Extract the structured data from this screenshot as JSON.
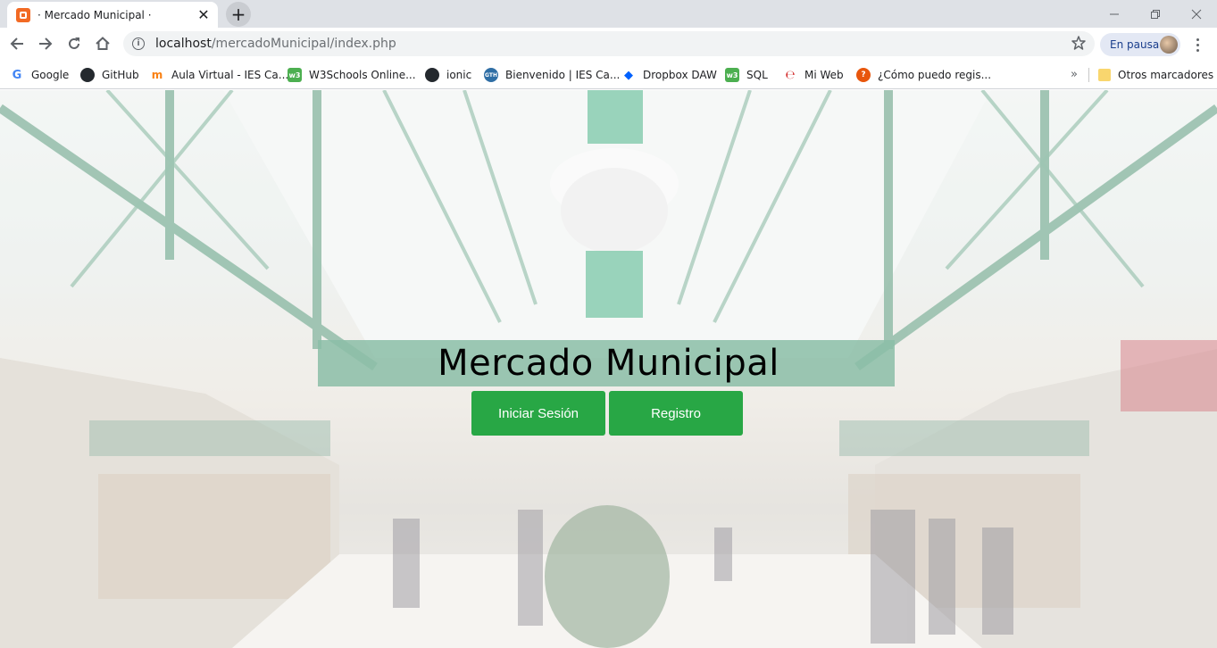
{
  "browser": {
    "tab": {
      "title": "· Mercado Municipal ·",
      "close_glyph": "✕"
    },
    "new_tab_glyph": "+",
    "url": {
      "host": "localhost",
      "path": "/mercadoMunicipal/index.php"
    },
    "profile_label": "En pausa",
    "bookmarks": [
      {
        "label": "Google",
        "icon": "google-icon",
        "color": "#4285f4"
      },
      {
        "label": "GitHub",
        "icon": "github-icon",
        "color": "#24292e"
      },
      {
        "label": "Aula Virtual - IES Ca...",
        "icon": "moodle-icon",
        "color": "#f98012"
      },
      {
        "label": "W3Schools Online...",
        "icon": "w3schools-icon",
        "color": "#4caf50"
      },
      {
        "label": "ionic",
        "icon": "github-icon",
        "color": "#24292e"
      },
      {
        "label": "Bienvenido | IES Ca...",
        "icon": "ies-icon",
        "color": "#2f6ea5"
      },
      {
        "label": "Dropbox DAW",
        "icon": "dropbox-icon",
        "color": "#0061fe"
      },
      {
        "label": "SQL",
        "icon": "w3schools-icon",
        "color": "#4caf50"
      },
      {
        "label": "Mi Web",
        "icon": "web-icon",
        "color": "#d32f2f"
      },
      {
        "label": "¿Cómo puedo regis...",
        "icon": "help-icon",
        "color": "#e8560c"
      }
    ],
    "more_bookmarks_glyph": "»",
    "other_bookmarks": "Otros marcadores"
  },
  "page": {
    "title": "Mercado Municipal",
    "login_button": "Iniciar Sesión",
    "register_button": "Registro",
    "accent_color": "#28a745"
  }
}
